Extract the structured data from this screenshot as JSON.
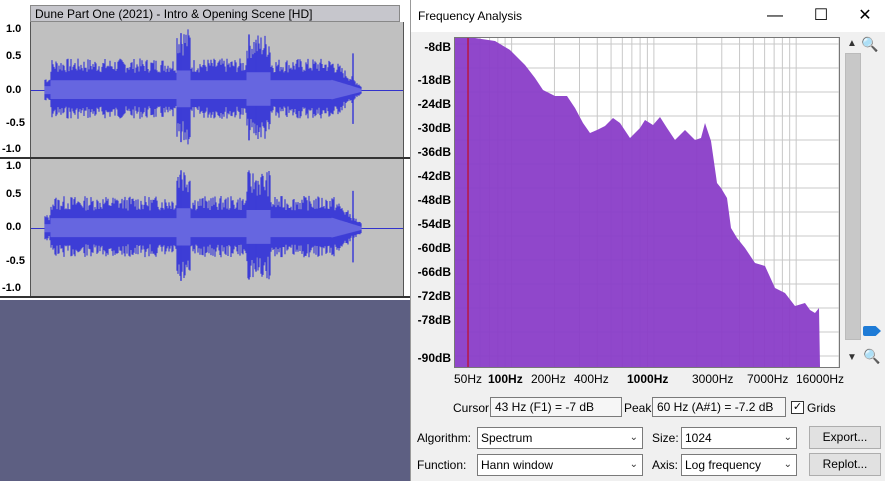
{
  "track": {
    "title": "Dune Part One (2021) - Intro & Opening Scene [HD]",
    "ruler_top": [
      "1.0",
      "0.5",
      "0.0",
      "-0.5",
      "-1.0"
    ],
    "ruler_bottom": [
      "1.0",
      "0.5",
      "0.0",
      "-0.5",
      "-1.0"
    ]
  },
  "window": {
    "title": "Frequency Analysis",
    "minimize_icon": "minimize-icon",
    "maximize_icon": "maximize-icon",
    "close_icon": "close-icon"
  },
  "plot": {
    "y_labels": [
      "-8dB",
      "-18dB",
      "-24dB",
      "-30dB",
      "-36dB",
      "-42dB",
      "-48dB",
      "-54dB",
      "-60dB",
      "-66dB",
      "-72dB",
      "-78dB",
      "-90dB"
    ],
    "x_labels": [
      "50Hz",
      "100Hz",
      "200Hz",
      "400Hz",
      "1000Hz",
      "3000Hz",
      "7000Hz",
      "16000Hz"
    ],
    "x_bold": [
      false,
      true,
      false,
      false,
      true,
      false,
      false,
      false
    ],
    "fill_color": "#8a3dc8",
    "cursor_line_color": "#cc0000"
  },
  "controls": {
    "cursor_label": "Cursor:",
    "cursor_value": "43 Hz (F1) = -7 dB",
    "peak_label": "Peak:",
    "peak_value": "60 Hz (A#1) = -7.2 dB",
    "grids_label": "Grids",
    "grids_checked": true,
    "algorithm_label": "Algorithm:",
    "algorithm_value": "Spectrum",
    "size_label": "Size:",
    "size_value": "1024",
    "export_label": "Export...",
    "function_label": "Function:",
    "function_value": "Hann window",
    "axis_label": "Axis:",
    "axis_value": "Log frequency",
    "replot_label": "Replot..."
  }
}
